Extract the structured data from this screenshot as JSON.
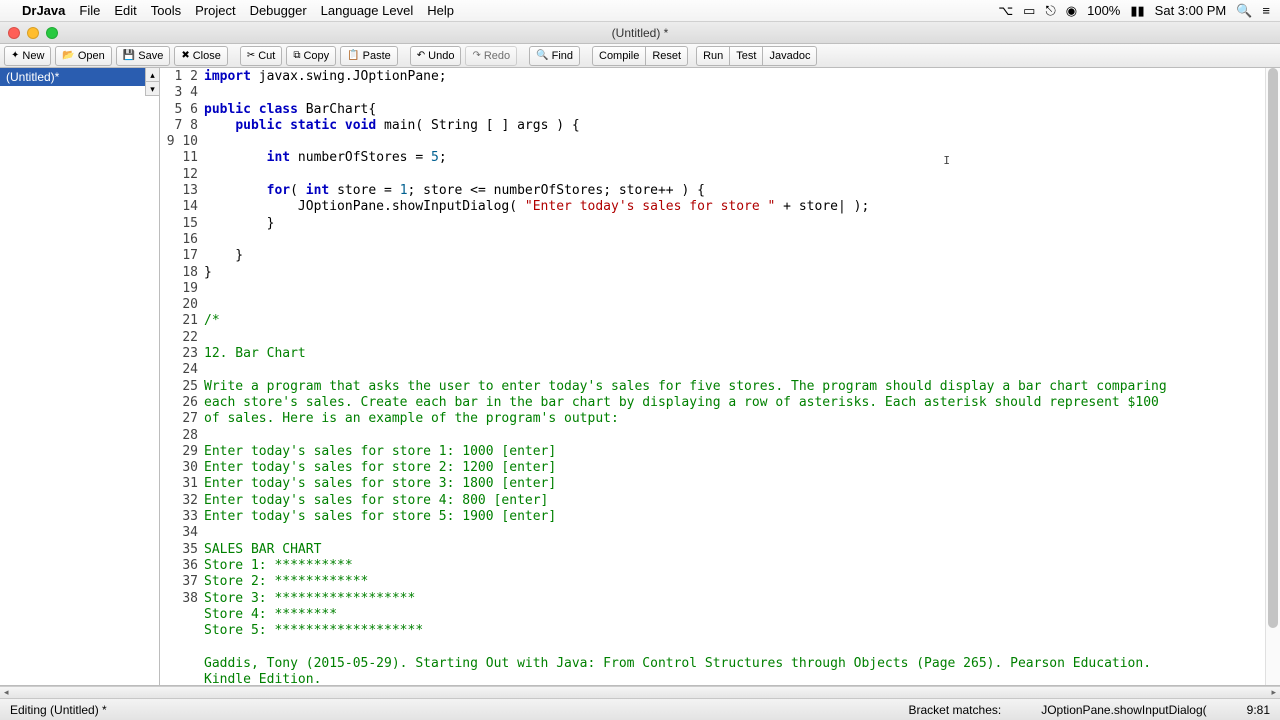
{
  "menubar": {
    "app": "DrJava",
    "items": [
      "File",
      "Edit",
      "Tools",
      "Project",
      "Debugger",
      "Language Level",
      "Help"
    ],
    "right": {
      "battery": "100%",
      "time": "Sat 3:00 PM"
    }
  },
  "window": {
    "title": "(Untitled) *"
  },
  "toolbar": {
    "new": "New",
    "open": "Open",
    "save": "Save",
    "close": "Close",
    "cut": "Cut",
    "copy": "Copy",
    "paste": "Paste",
    "undo": "Undo",
    "redo": "Redo",
    "find": "Find",
    "compile": "Compile",
    "reset": "Reset",
    "run": "Run",
    "test": "Test",
    "javadoc": "Javadoc"
  },
  "sidebar": {
    "file": "(Untitled)*"
  },
  "editor": {
    "first_line": 1,
    "lines": [
      {
        "t": "code",
        "seg": [
          [
            "kw",
            "import"
          ],
          [
            "",
            " javax.swing.JOptionPane;"
          ]
        ]
      },
      {
        "t": "blank"
      },
      {
        "t": "code",
        "seg": [
          [
            "kw",
            "public"
          ],
          [
            "",
            " "
          ],
          [
            "kw",
            "class"
          ],
          [
            "",
            " BarChart{"
          ]
        ]
      },
      {
        "t": "code",
        "seg": [
          [
            "",
            "    "
          ],
          [
            "kw",
            "public"
          ],
          [
            "",
            " "
          ],
          [
            "kw",
            "static"
          ],
          [
            "",
            " "
          ],
          [
            "kw",
            "void"
          ],
          [
            "",
            " main( String [ ] args ) {"
          ]
        ]
      },
      {
        "t": "blank"
      },
      {
        "t": "code",
        "seg": [
          [
            "",
            "        "
          ],
          [
            "kw",
            "int"
          ],
          [
            "",
            " numberOfStores = "
          ],
          [
            "num",
            "5"
          ],
          [
            "",
            ";"
          ]
        ]
      },
      {
        "t": "blank"
      },
      {
        "t": "code",
        "seg": [
          [
            "",
            "        "
          ],
          [
            "kw",
            "for"
          ],
          [
            "",
            "( "
          ],
          [
            "kw",
            "int"
          ],
          [
            "",
            " store = "
          ],
          [
            "num",
            "1"
          ],
          [
            "",
            "; store <= numberOfStores; store++ ) {"
          ]
        ]
      },
      {
        "t": "code",
        "seg": [
          [
            "",
            "            JOptionPane.showInputDialog( "
          ],
          [
            "str",
            "\"Enter today's sales for store \""
          ],
          [
            "",
            " + store| );"
          ]
        ]
      },
      {
        "t": "code",
        "seg": [
          [
            "",
            "        }"
          ]
        ]
      },
      {
        "t": "blank"
      },
      {
        "t": "code",
        "seg": [
          [
            "",
            "    }"
          ]
        ]
      },
      {
        "t": "code",
        "seg": [
          [
            "",
            "}"
          ]
        ]
      },
      {
        "t": "blank"
      },
      {
        "t": "blank"
      },
      {
        "t": "cm",
        "v": "/*"
      },
      {
        "t": "blank"
      },
      {
        "t": "cm",
        "v": "12. Bar Chart"
      },
      {
        "t": "blank"
      },
      {
        "t": "cm",
        "v": "Write a program that asks the user to enter today's sales for five stores. The program should display a bar chart comparing"
      },
      {
        "t": "cm",
        "v": "each store's sales. Create each bar in the bar chart by displaying a row of asterisks. Each asterisk should represent $100"
      },
      {
        "t": "cm",
        "v": "of sales. Here is an example of the program's output:"
      },
      {
        "t": "blank"
      },
      {
        "t": "cm",
        "v": "Enter today's sales for store 1: 1000 [enter]"
      },
      {
        "t": "cm",
        "v": "Enter today's sales for store 2: 1200 [enter]"
      },
      {
        "t": "cm",
        "v": "Enter today's sales for store 3: 1800 [enter]"
      },
      {
        "t": "cm",
        "v": "Enter today's sales for store 4: 800 [enter]"
      },
      {
        "t": "cm",
        "v": "Enter today's sales for store 5: 1900 [enter]"
      },
      {
        "t": "blank"
      },
      {
        "t": "cm",
        "v": "SALES BAR CHART"
      },
      {
        "t": "cm",
        "v": "Store 1: **********"
      },
      {
        "t": "cm",
        "v": "Store 2: ************"
      },
      {
        "t": "cm",
        "v": "Store 3: ******************"
      },
      {
        "t": "cm",
        "v": "Store 4: ********"
      },
      {
        "t": "cm",
        "v": "Store 5: *******************"
      },
      {
        "t": "blank"
      },
      {
        "t": "cm",
        "v": "Gaddis, Tony (2015-05-29). Starting Out with Java: From Control Structures through Objects (Page 265). Pearson Education."
      },
      {
        "t": "cm",
        "v": "Kindle Edition."
      }
    ]
  },
  "status": {
    "left": "Editing (Untitled) *",
    "bracket_label": "Bracket matches:",
    "bracket_value": "JOptionPane.showInputDialog(",
    "position": "9:81"
  }
}
